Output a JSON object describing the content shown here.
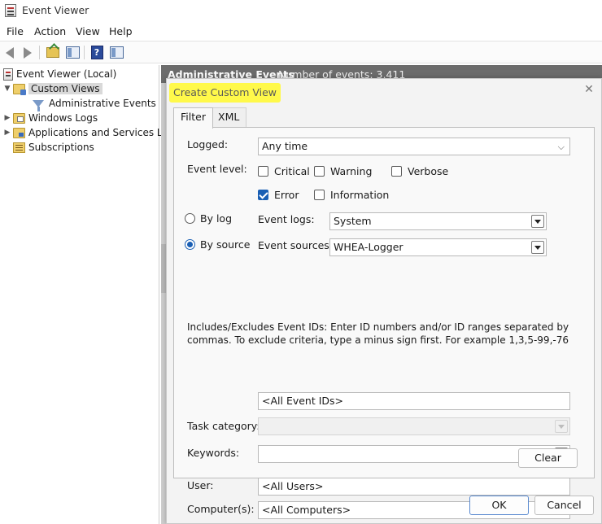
{
  "window": {
    "title": "Event Viewer"
  },
  "menu": [
    "File",
    "Action",
    "View",
    "Help"
  ],
  "tree": {
    "root": "Event Viewer (Local)",
    "custom_views": "Custom Views",
    "admin_events": "Administrative Events",
    "windows_logs": "Windows Logs",
    "apps_services": "Applications and Services Lo",
    "subscriptions": "Subscriptions"
  },
  "background_panel": {
    "title": "Administrative Events",
    "count_label": "Number of events: 3,411"
  },
  "dialog": {
    "title": "Create Custom View",
    "highlight_color": "#fff94a",
    "tabs": [
      "Filter",
      "XML"
    ],
    "logged_label": "Logged:",
    "logged_value": "Any time",
    "event_level_label": "Event level:",
    "levels": {
      "critical": {
        "label": "Critical",
        "checked": false
      },
      "warning": {
        "label": "Warning",
        "checked": false
      },
      "verbose": {
        "label": "Verbose",
        "checked": false
      },
      "error": {
        "label": "Error",
        "checked": true
      },
      "information": {
        "label": "Information",
        "checked": false
      }
    },
    "by_log": {
      "label": "By log",
      "selected": false
    },
    "by_source": {
      "label": "By source",
      "selected": true
    },
    "event_logs_label": "Event logs:",
    "event_logs_value": "System",
    "event_sources_label": "Event sources:",
    "event_sources_value": "WHEA-Logger",
    "ids_description": "Includes/Excludes Event IDs: Enter ID numbers and/or ID ranges separated by commas. To exclude criteria, type a minus sign first. For example 1,3,5-99,-76",
    "event_ids_value": "<All Event IDs>",
    "task_category_label": "Task category:",
    "task_category_value": "",
    "keywords_label": "Keywords:",
    "keywords_value": "",
    "user_label": "User:",
    "user_value": "<All Users>",
    "computers_label": "Computer(s):",
    "computers_value": "<All Computers>",
    "clear_label": "Clear",
    "ok_label": "OK",
    "cancel_label": "Cancel"
  }
}
